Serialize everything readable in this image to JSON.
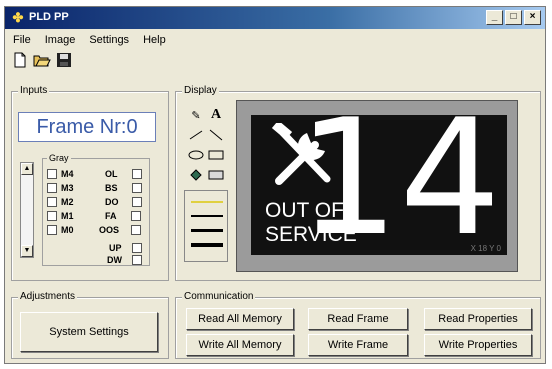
{
  "window": {
    "title": "PLD PP",
    "controls": [
      "_",
      "□",
      "×"
    ]
  },
  "menu": [
    "File",
    "Image",
    "Settings",
    "Help"
  ],
  "toolbar": [
    "new-icon",
    "open-icon",
    "save-icon"
  ],
  "inputs": {
    "label": "Inputs",
    "frame_display": "Frame Nr:0",
    "gray_label": "Gray",
    "gray_bits": [
      "M4",
      "M3",
      "M2",
      "M1",
      "M0"
    ],
    "status_flags": [
      "OL",
      "BS",
      "DO",
      "FA",
      "OOS"
    ],
    "dir_flags": [
      "UP",
      "DW"
    ]
  },
  "display": {
    "label": "Display",
    "tools": [
      "pencil-icon",
      "text-icon",
      "line-icon",
      "diagonal-line-icon",
      "ellipse-icon",
      "rectangle-icon",
      "fill-icon",
      "filled-rectangle-icon"
    ],
    "screen": {
      "line1": "OUT OF",
      "line2": "SERVICE",
      "number": "14",
      "resolution": "X 18 Y 0"
    }
  },
  "adjustments": {
    "label": "Adjustments",
    "button": "System Settings"
  },
  "communication": {
    "label": "Communication",
    "read_all": "Read All Memory",
    "read_frame": "Read Frame",
    "read_props": "Read Properties",
    "write_all": "Write All Memory",
    "write_frame": "Write Frame",
    "write_props": "Write Properties"
  }
}
